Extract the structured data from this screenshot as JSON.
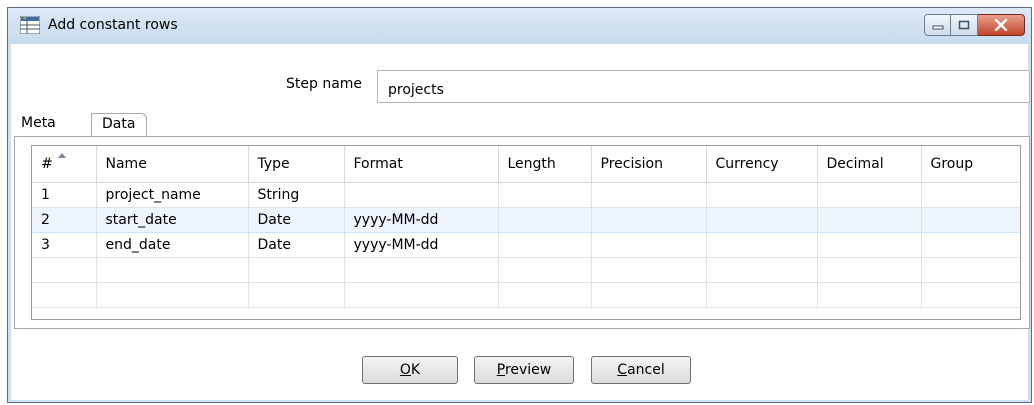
{
  "window": {
    "title": "Add constant rows"
  },
  "step": {
    "label": "Step name",
    "value": "projects"
  },
  "tabs": [
    {
      "label": "Meta",
      "active": true
    },
    {
      "label": "Data",
      "active": false
    }
  ],
  "table": {
    "columns": [
      "#",
      "Name",
      "Type",
      "Format",
      "Length",
      "Precision",
      "Currency",
      "Decimal",
      "Group"
    ],
    "rows": [
      [
        "1",
        "project_name",
        "String",
        "",
        "",
        "",
        "",
        "",
        ""
      ],
      [
        "2",
        "start_date",
        "Date",
        "yyyy-MM-dd",
        "",
        "",
        "",
        "",
        ""
      ],
      [
        "3",
        "end_date",
        "Date",
        "yyyy-MM-dd",
        "",
        "",
        "",
        "",
        ""
      ],
      [
        "",
        "",
        "",
        "",
        "",
        "",
        "",
        "",
        ""
      ],
      [
        "",
        "",
        "",
        "",
        "",
        "",
        "",
        "",
        ""
      ]
    ],
    "selected_row": 2
  },
  "buttons": {
    "ok": {
      "mnemonic": "O",
      "rest": "K"
    },
    "preview": {
      "mnemonic": "P",
      "rest": "review"
    },
    "cancel": {
      "mnemonic": "C",
      "rest": "ancel"
    }
  },
  "icons": {
    "app": "table-icon",
    "minimize": "minimize-icon",
    "maximize": "maximize-icon",
    "close": "close-icon",
    "sort": "sort-ascending-icon"
  },
  "colors": {
    "titlebar": "#cfe0f2",
    "close_button": "#c4442b",
    "selected_row": "#edf4fc"
  }
}
